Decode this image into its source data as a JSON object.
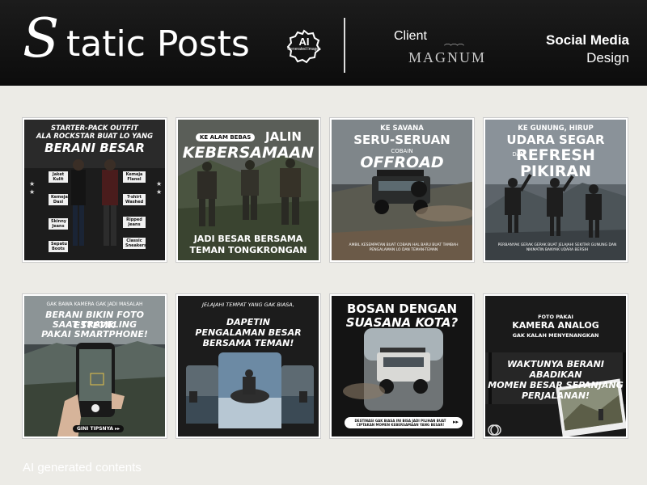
{
  "header": {
    "title_first_letter": "S",
    "title_rest": "tatic Posts",
    "badge_title": "AI",
    "badge_subtitle": "Generated Images",
    "client_label": "Client",
    "client_brand": "MAGNUM",
    "category_line1": "Social Media",
    "category_line2": "Design"
  },
  "posts": [
    {
      "line1": "STARTER-PACK OUTFIT",
      "line2": "ALA ROCKSTAR BUAT LO YANG",
      "line3": "BERANI BESAR",
      "tags": [
        "Jaket Kulit",
        "Kemeja Dasi",
        "Skinny Jeans",
        "Sepatu Boots",
        "Kemeja Flanel",
        "T-shirt Washed",
        "Ripped Jeans",
        "Classic Sneakers"
      ]
    },
    {
      "line1": "KE ALAM BEBAS",
      "line2": "JALIN",
      "line3": "KEBERSAMAAN",
      "line4": "JADI BESAR BERSAMA",
      "line5": "TEMAN TONGKRONGAN"
    },
    {
      "line1": "KE SAVANA",
      "line2": "SERU-SERUAN",
      "line3": "COBAIN",
      "line4": "OFFROAD",
      "caption": "AMBIL KESEMPATAN BUAT COBAIN HAL BARU BUAT TAMBAH PENGALAMAN LO DAN TEMAN-TEMAN"
    },
    {
      "line1": "KE GUNUNG, HIRUP",
      "line2": "UDARA SEGAR",
      "line3": "DAN",
      "line4": "REFRESH",
      "line5": "PIKIRAN",
      "caption": "PERBANYAK GERAK GERAK BUAT JELAJAHI SEKITAR GUNUNG DAN NIKMATIN BANYAK UDARA BERSIH"
    },
    {
      "line1": "GAK BAWA KAMERA GAK JADI MASALAH",
      "line2": "BERANI BIKIN FOTO ESTETIK",
      "line3": "SAAT TRAVELING",
      "line4": "PAKAI SMARTPHONE!",
      "button": "GINI TIPSNYA ▸▸"
    },
    {
      "line1": "JELAJAHI TEMPAT YANG GAK BIASA,",
      "line2": "DAPETIN",
      "line3": "PENGALAMAN BESAR",
      "line4": "BERSAMA TEMAN!"
    },
    {
      "line1": "BOSAN DENGAN",
      "line2": "SUASANA KOTA?",
      "button": "DESTINASI GAK BIASA INI BISA JADI PILIHAN BUAT CIPTAKAN MOMEN KEBERSAMAAN YANG BESAR!"
    },
    {
      "line1": "FOTO PAKAI",
      "line2": "KAMERA ANALOG",
      "line3": "GAK KALAH MENYENANGKAN",
      "line4": "WAKTUNYA BERANI",
      "line5": "ABADIKAN",
      "line6": "MOMEN BESAR SEPANJANG",
      "line7": "PERJALANAN!"
    }
  ],
  "footer": {
    "note": "AI generated contents"
  }
}
